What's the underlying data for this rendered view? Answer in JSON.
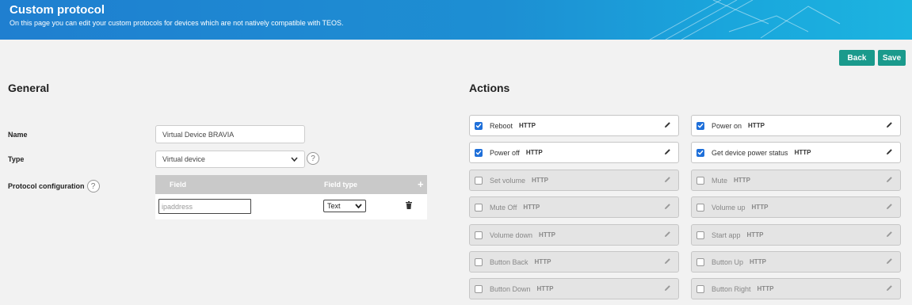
{
  "header": {
    "title": "Custom protocol",
    "subtitle": "On this page you can edit your custom protocols for devices which are not natively compatible with TEOS."
  },
  "toolbar": {
    "back_label": "Back",
    "save_label": "Save"
  },
  "general": {
    "heading": "General",
    "name_label": "Name",
    "name_value": "Virtual Device BRAVIA",
    "type_label": "Type",
    "type_value": "Virtual device",
    "protocol_label": "Protocol configuration",
    "help_glyph": "?",
    "table": {
      "col_field": "Field",
      "col_field_type": "Field type",
      "add_glyph": "+",
      "row": {
        "field_placeholder": "ipaddress",
        "field_type": "Text"
      }
    }
  },
  "actions": {
    "heading": "Actions",
    "items": [
      {
        "label": "Reboot",
        "type": "HTTP",
        "checked": true
      },
      {
        "label": "Power on",
        "type": "HTTP",
        "checked": true
      },
      {
        "label": "Power off",
        "type": "HTTP",
        "checked": true
      },
      {
        "label": "Get device power status",
        "type": "HTTP",
        "checked": true
      },
      {
        "label": "Set volume",
        "type": "HTTP",
        "checked": false
      },
      {
        "label": "Mute",
        "type": "HTTP",
        "checked": false
      },
      {
        "label": "Mute Off",
        "type": "HTTP",
        "checked": false
      },
      {
        "label": "Volume up",
        "type": "HTTP",
        "checked": false
      },
      {
        "label": "Volume down",
        "type": "HTTP",
        "checked": false
      },
      {
        "label": "Start app",
        "type": "HTTP",
        "checked": false
      },
      {
        "label": "Button Back",
        "type": "HTTP",
        "checked": false
      },
      {
        "label": "Button Up",
        "type": "HTTP",
        "checked": false
      },
      {
        "label": "Button Down",
        "type": "HTTP",
        "checked": false
      },
      {
        "label": "Button Right",
        "type": "HTTP",
        "checked": false
      }
    ]
  },
  "colors": {
    "accent": "#1a9a8c",
    "banner": "#1d8fd3",
    "checkbox": "#1e6fd9"
  },
  "icons": {
    "edit": "pencil-icon",
    "delete": "trash-icon",
    "dropdown": "chevron-down-icon",
    "help": "help-icon"
  }
}
